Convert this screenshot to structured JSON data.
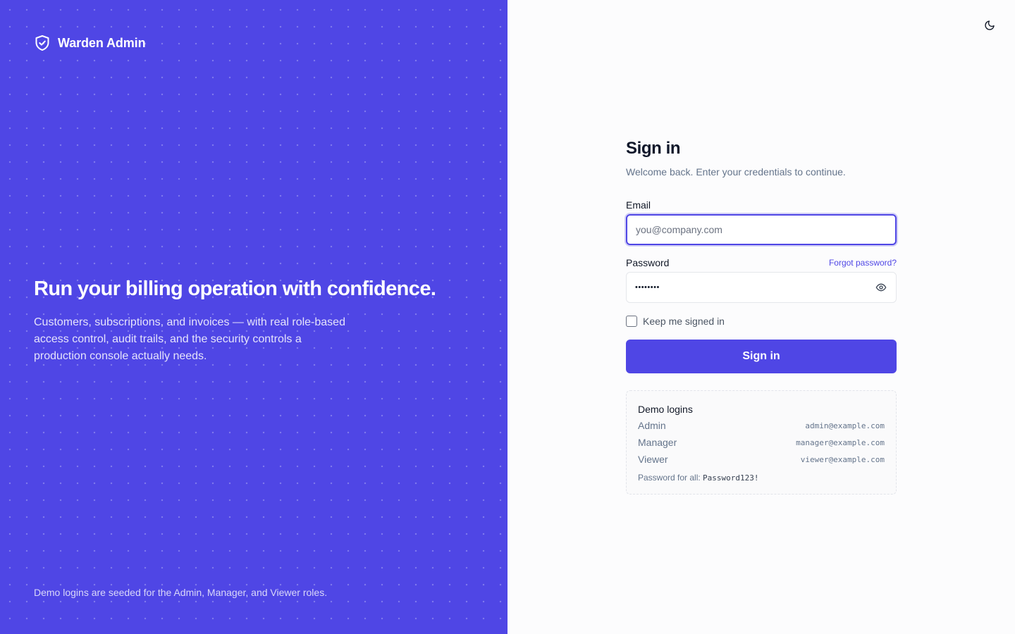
{
  "brand": {
    "name": "Warden Admin",
    "hero_title": "Run your billing operation with confidence.",
    "hero_description": "Customers, subscriptions, and invoices — with real role-based access control, audit trails, and the security controls a production console actually needs.",
    "footer_note": "Demo logins are seeded for the Admin, Manager, and Viewer roles.",
    "accent_color": "#4f46e5"
  },
  "header": {
    "theme_toggle_icon": "moon-icon"
  },
  "form": {
    "title": "Sign in",
    "subtitle": "Welcome back. Enter your credentials to continue.",
    "email_label": "Email",
    "email_placeholder": "you@company.com",
    "email_value": "",
    "password_label": "Password",
    "forgot_label": "Forgot password?",
    "password_value": "••••••••",
    "remember_label": "Keep me signed in",
    "submit_label": "Sign in"
  },
  "demo": {
    "title": "Demo logins",
    "accounts": [
      {
        "role": "Admin",
        "email": "admin@example.com"
      },
      {
        "role": "Manager",
        "email": "manager@example.com"
      },
      {
        "role": "Viewer",
        "email": "viewer@example.com"
      }
    ],
    "password_prefix": "Password for all:",
    "password": "Password123!"
  }
}
